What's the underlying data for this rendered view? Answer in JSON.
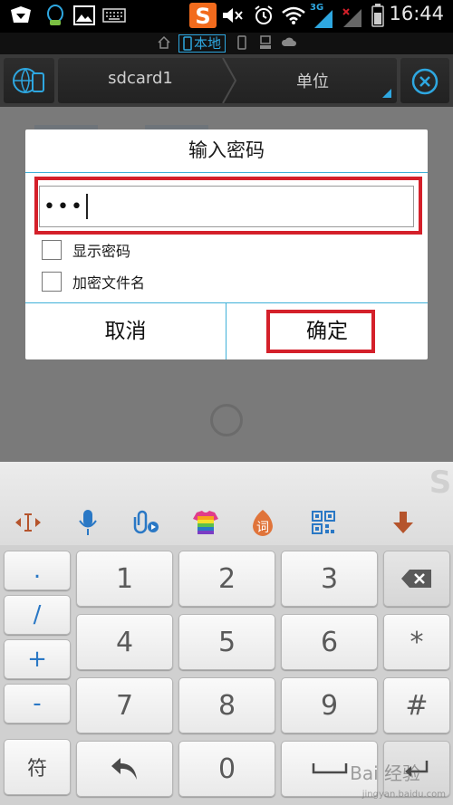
{
  "status_bar": {
    "time": "16:44",
    "network": "3G",
    "icons": [
      "notification-app-icon",
      "qq-icon",
      "image-icon",
      "keyboard-icon",
      "sogou-icon",
      "mute-icon",
      "alarm-icon",
      "wifi-icon",
      "signal-icon",
      "signal-off-icon",
      "battery-icon"
    ]
  },
  "location_bar": {
    "local_label": "本地"
  },
  "toolbar": {
    "path_label": "sdcard1",
    "unit_label": "单位"
  },
  "dialog": {
    "title": "输入密码",
    "password_value": "•••",
    "show_password_label": "显示密码",
    "encrypt_filename_label": "加密文件名",
    "cancel_label": "取消",
    "confirm_label": "确定"
  },
  "keyboard": {
    "toolbar_icons": [
      "cursor-move-icon",
      "microphone-icon",
      "attach-icon",
      "skin-icon",
      "word-icon",
      "qrcode-icon",
      "hide-keyboard-icon"
    ],
    "word_icon_text": "词",
    "side_keys": [
      ".",
      "/",
      "+",
      "-"
    ],
    "symbol_key": "符",
    "digits": [
      "1",
      "2",
      "3",
      "4",
      "5",
      "6",
      "7",
      "8",
      "9",
      "0"
    ],
    "right_keys": [
      "*",
      "#"
    ],
    "accent_color": "#2a78c5"
  },
  "watermark": {
    "text": "Bai 经验",
    "sub": "jingyan.baidu.com"
  }
}
